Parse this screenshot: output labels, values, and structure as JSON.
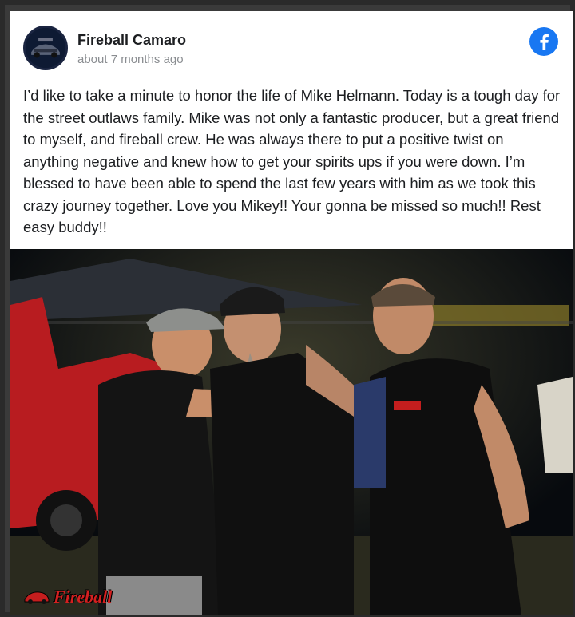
{
  "post": {
    "author": "Fireball Camaro",
    "timestamp": "about 7 months ago",
    "text": "I’d like to take a minute to honor the life of Mike Helmann. Today is a tough day for the street outlaws family. Mike was not only a fantastic producer, but a great friend to myself, and fireball crew. He was always there to put a positive twist on anything negative and knew how to get your spirits ups if you were down. I’m blessed to have been able to spend the last few years with him as we took this crazy journey together. Love you Mikey!! Your gonna be missed so much!! Rest easy buddy!!",
    "watermark": "Fireball"
  },
  "icons": {
    "platform": "facebook-icon",
    "avatar": "camaro-avatar"
  },
  "colors": {
    "facebook_blue": "#1877f2",
    "text_primary": "#1c1e21",
    "text_secondary": "#8a8d91",
    "watermark_red": "#d32020"
  }
}
